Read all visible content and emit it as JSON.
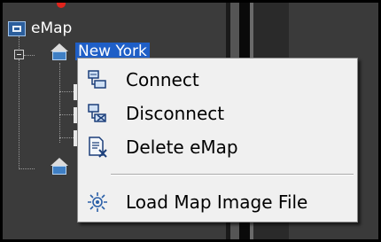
{
  "tree": {
    "root_label": "eMap",
    "selected_node_label": "New York"
  },
  "context_menu": {
    "items": [
      {
        "label": "Connect",
        "icon": "connect-icon"
      },
      {
        "label": "Disconnect",
        "icon": "disconnect-icon"
      },
      {
        "label": "Delete eMap",
        "icon": "delete-emap-icon"
      },
      {
        "label": "Load Map Image File",
        "icon": "load-map-image-icon"
      }
    ]
  },
  "colors": {
    "selection": "#1f5fc7",
    "menu_background": "#f0f0f0",
    "panel_background": "#3b3b3b"
  }
}
